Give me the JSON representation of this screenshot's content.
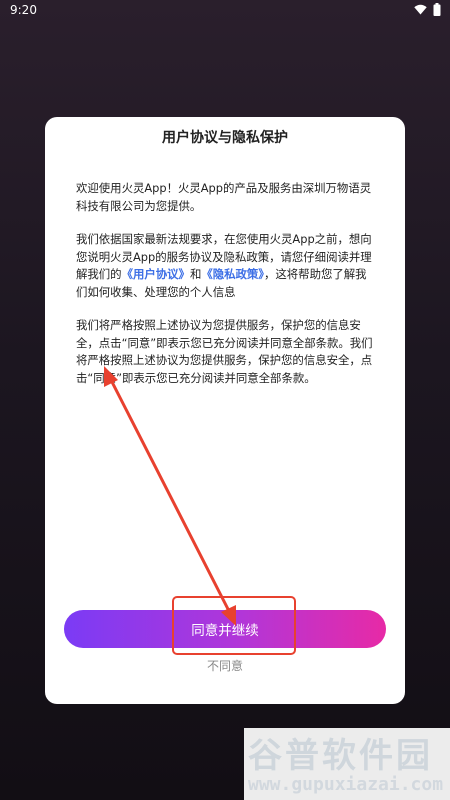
{
  "status_bar": {
    "time": "9:20",
    "icons": [
      "wifi-icon",
      "battery-icon"
    ]
  },
  "dialog": {
    "title": "用户协议与隐私保护",
    "para1": "欢迎使用火灵App！火灵App的产品及服务由深圳万物语灵科技有限公司为您提供。",
    "para2_prefix": "我们依据国家最新法规要求，在您使用火灵App之前，想向您说明火灵App的服务协议及隐私政策，请您仔细阅读并理解我们的",
    "user_agreement_link": "《用户协议》",
    "and": "和",
    "privacy_link": "《隐私政策》",
    "para2_suffix": "，这将帮助您了解我们如何收集、处理您的个人信息",
    "para3": "我们将严格按照上述协议为您提供服务，保护您的信息安全，点击“同意”即表示您已充分阅读并同意全部条款。我们将严格按照上述协议为您提供服务，保护您的信息安全，点击“同意”即表示您已充分阅读并同意全部条款。",
    "agree_button": "同意并继续",
    "disagree_label": "不同意"
  },
  "annotation": {
    "color": "#e8412f"
  },
  "watermark": {
    "logo_text": "谷普软件园",
    "url": "www.gupuxiazai.com"
  }
}
